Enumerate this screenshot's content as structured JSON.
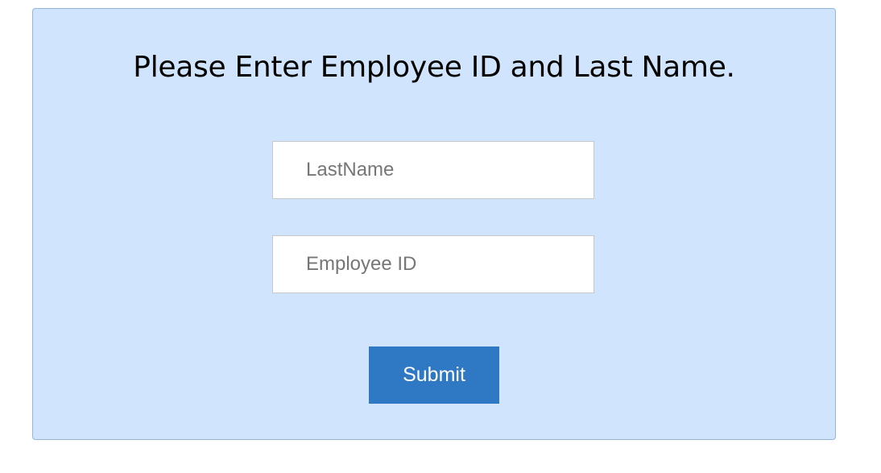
{
  "form": {
    "title": "Please Enter Employee ID and Last Name.",
    "last_name": {
      "value": "",
      "placeholder": "LastName"
    },
    "employee_id": {
      "value": "",
      "placeholder": "Employee ID"
    },
    "submit_label": "Submit"
  }
}
